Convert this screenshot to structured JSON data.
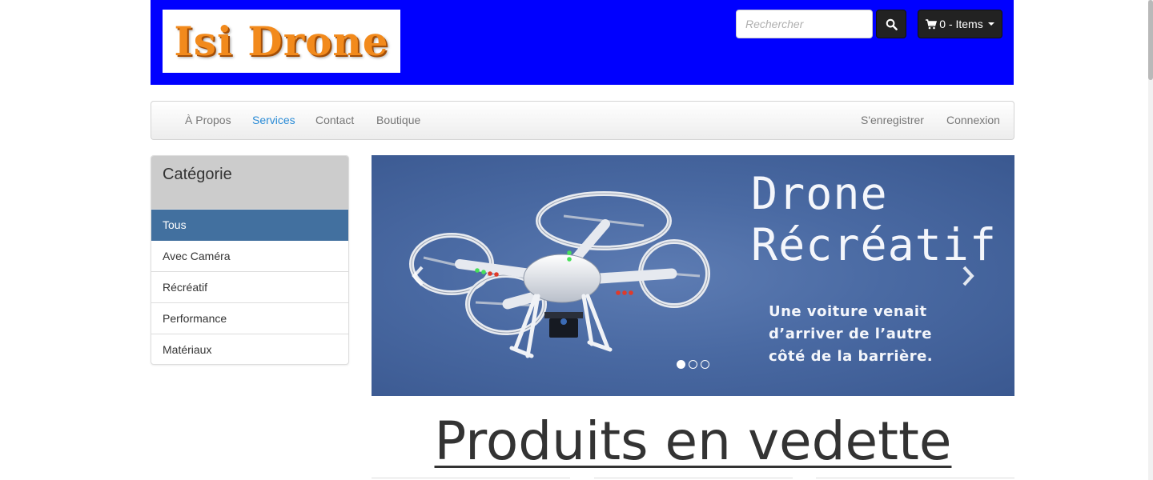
{
  "brand": {
    "logo_text": "Isi Drone"
  },
  "search": {
    "placeholder": "Rechercher"
  },
  "cart": {
    "label": "0 - Items"
  },
  "nav": {
    "left": [
      "À Propos",
      "Services",
      "Contact",
      "Boutique"
    ],
    "active": "Services",
    "right": [
      "S'enregistrer",
      "Connexion"
    ]
  },
  "sidebar": {
    "title": "Catégorie",
    "items": [
      "Tous",
      "Avec Caméra",
      "Récréatif",
      "Performance",
      "Matériaux"
    ],
    "active": "Tous"
  },
  "carousel": {
    "title_line1": "Drone",
    "title_line2": "Récréatif",
    "text_line1": "Une voiture venait",
    "text_line2": "d’arriver de l’autre",
    "text_line3": "côté de la barrière.",
    "slides": 3,
    "active_slide": 1
  },
  "featured": {
    "heading": "Produits en vedette"
  },
  "colors": {
    "header_bg": "#0000ff",
    "active_link": "#2a8bd6",
    "sidebar_active": "#42709f",
    "carousel_bg": "#4a6aa3"
  }
}
